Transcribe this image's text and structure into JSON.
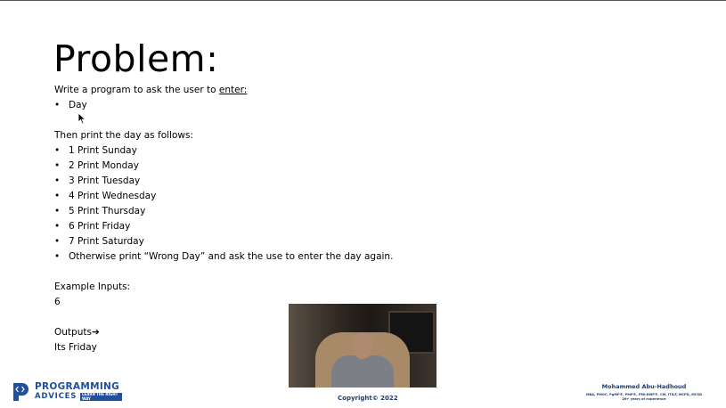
{
  "slide": {
    "title": "Problem:",
    "intro_prefix": "Write a program to ask the user to ",
    "intro_link": "enter:",
    "input_items": [
      "Day"
    ],
    "then_text": "Then print the day as follows:",
    "rules": [
      "1 Print Sunday",
      "2 Print Monday",
      "3 Print Tuesday",
      "4 Print Wednesday",
      "5 Print Thursday",
      "6 Print Friday",
      "7 Print Saturday",
      "Otherwise print “Wrong Day” and ask the use to enter the day again."
    ],
    "example_label": "Example Inputs:",
    "example_value": "6",
    "outputs_label": "Outputs",
    "outputs_arrow": "➔",
    "outputs_value": "Its Friday",
    "bullet_char": "•"
  },
  "footer": {
    "copyright": "Copyright© 2022",
    "logo_line1": "PROGRAMMING",
    "logo_line2": "ADVICES",
    "logo_tag": "LEARN THE RIGHT WAY",
    "author_name": "Mohammed Abu-Hadhoud",
    "author_credentials": "MBA, PMOC, PgMP®, PMP®, PMI-RMP®, CM, ITILF, MCPD, MCSD",
    "author_experience": "26+ years of experience"
  },
  "colors": {
    "brand": "#1f4f9e",
    "footer_text": "#1f3c6e"
  }
}
